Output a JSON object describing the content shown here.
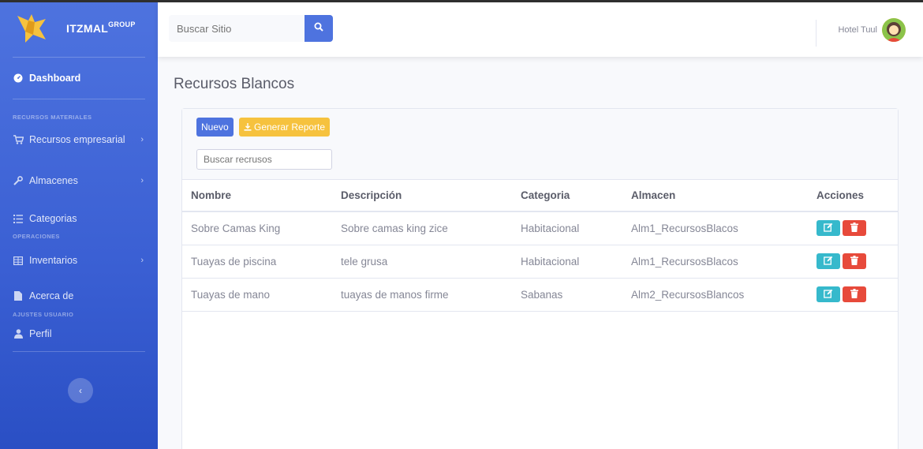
{
  "brand": {
    "name": "ITZMAL",
    "suffix": "GROUP"
  },
  "sidebar": {
    "dashboard": "Dashboard",
    "heading_materials": "RECURSOS MATERIALES",
    "recursos": "Recursos empresarial",
    "almacenes": "Almacenes",
    "categorias": "Categorias",
    "heading_operations": "OPERACIONES",
    "inventarios": "Inventarios",
    "acerca": "Acerca de",
    "heading_settings": "AJUSTES USUARIO",
    "perfil": "Perfil"
  },
  "topbar": {
    "search_placeholder": "Buscar Sitio",
    "user_name": "Hotel Tuul"
  },
  "page": {
    "title": "Recursos Blancos"
  },
  "toolbar": {
    "new_label": "Nuevo",
    "report_label": "Generar Reporte",
    "filter_placeholder": "Buscar recrusos"
  },
  "table": {
    "headers": [
      "Nombre",
      "Descripción",
      "Categoria",
      "Almacen",
      "Acciones"
    ],
    "rows": [
      [
        "Sobre Camas King",
        "Sobre camas king zice",
        "Habitacional",
        "Alm1_RecursosBlacos"
      ],
      [
        "Tuayas de piscina",
        "tele grusa",
        "Habitacional",
        "Alm1_RecursosBlacos"
      ],
      [
        "Tuayas de mano",
        "tuayas de manos firme",
        "Sabanas",
        "Alm2_RecursosBlancos"
      ]
    ]
  },
  "colors": {
    "primary": "#4e73df",
    "warning": "#f6c23e",
    "info": "#36b9cc",
    "danger": "#e74a3b"
  }
}
